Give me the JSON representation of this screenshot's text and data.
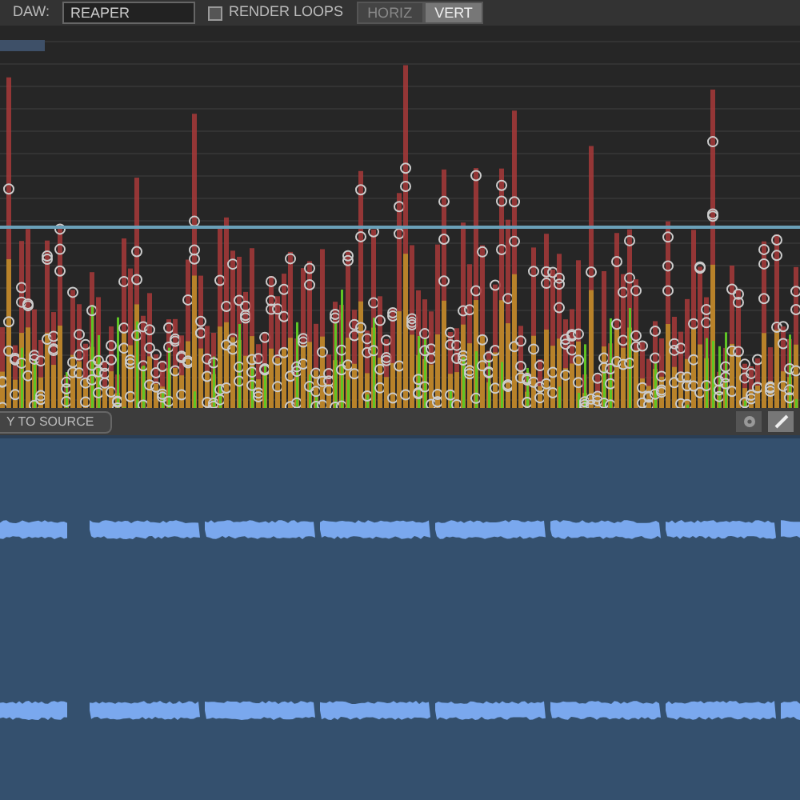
{
  "toolbar": {
    "daw_label": "DAW:",
    "daw_value": "REAPER",
    "render_loops": {
      "label": "RENDER LOOPS",
      "checked": false
    },
    "orientation": [
      {
        "label": "HORIZ",
        "selected": false
      },
      {
        "label": "VERT",
        "selected": true
      }
    ]
  },
  "bottom_bar": {
    "button": "Y TO SOURCE",
    "tools": [
      {
        "kind": "gear",
        "selected": false
      },
      {
        "kind": "pencil",
        "selected": true
      }
    ]
  }
}
